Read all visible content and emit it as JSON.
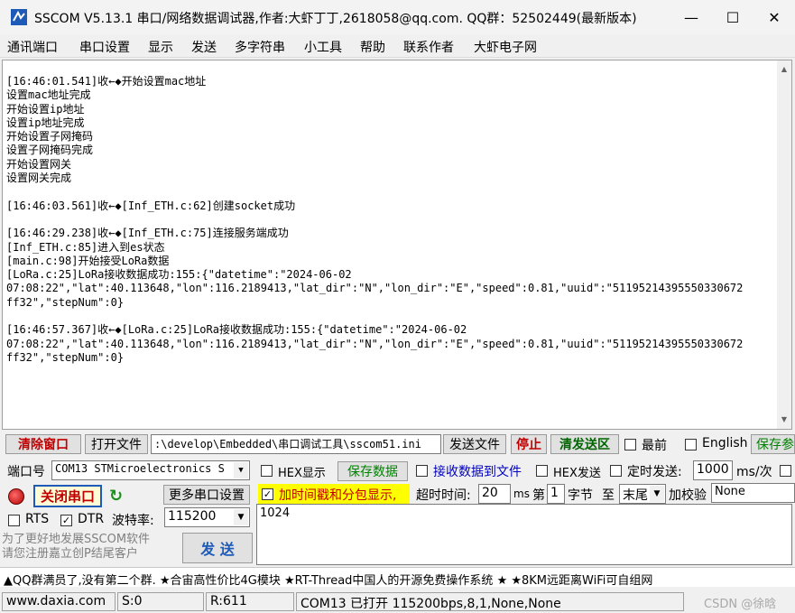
{
  "window": {
    "title": "SSCOM V5.13.1 串口/网络数据调试器,作者:大虾丁丁,2618058@qq.com. QQ群：52502449(最新版本)",
    "minimize": "—",
    "maximize": "☐",
    "close": "✕"
  },
  "menu": [
    "通讯端口",
    "串口设置",
    "显示",
    "发送",
    "多字符串",
    "小工具",
    "帮助",
    "联系作者",
    "大虾电子网"
  ],
  "receive": {
    "lines": [
      "[16:46:01.541]收←◆开始设置mac地址",
      "设置mac地址完成",
      "开始设置ip地址",
      "设置ip地址完成",
      "开始设置子网掩码",
      "设置子网掩码完成",
      "开始设置网关",
      "设置网关完成",
      "",
      "[16:46:03.561]收←◆[Inf_ETH.c:62]创建socket成功",
      "",
      "[16:46:29.238]收←◆[Inf_ETH.c:75]连接服务端成功",
      "[Inf_ETH.c:85]进入到es状态",
      "[main.c:98]开始接受LoRa数据",
      "[LoRa.c:25]LoRa接收数据成功:155:{\"datetime\":\"2024-06-02",
      "07:08:22\",\"lat\":40.113648,\"lon\":116.2189413,\"lat_dir\":\"N\",\"lon_dir\":\"E\",\"speed\":0.81,\"uuid\":\"51195214395550330672",
      "ff32\",\"stepNum\":0}",
      "",
      "[16:46:57.367]收←◆[LoRa.c:25]LoRa接收数据成功:155:{\"datetime\":\"2024-06-02",
      "07:08:22\",\"lat\":40.113648,\"lon\":116.2189413,\"lat_dir\":\"N\",\"lon_dir\":\"E\",\"speed\":0.81,\"uuid\":\"51195214395550330672",
      "ff32\",\"stepNum\":0}"
    ]
  },
  "toolbar": {
    "clear_window": "清除窗口",
    "open_file": "打开文件",
    "file_path": ":\\develop\\Embedded\\串口调试工具\\sscom51.ini",
    "send_file": "发送文件",
    "stop": "停止",
    "clear_send": "清发送区",
    "topmost": "最前",
    "english": "English",
    "save_params": "保存参"
  },
  "port": {
    "port_label": "端口号",
    "port_value": "COM13 STMicroelectronics S",
    "close_port": "关闭串口",
    "more_settings": "更多串口设置",
    "rts": "RTS",
    "dtr": "DTR",
    "baud_label": "波特率:",
    "baud_value": "115200"
  },
  "display": {
    "hex_display": "HEX显示",
    "save_data": "保存数据",
    "recv_to_file": "接收数据到文件",
    "hex_send": "HEX发送",
    "timed_send": "定时发送:",
    "interval": "1000",
    "interval_unit": "ms/次",
    "timestamp": "加时间戳和分包显示,",
    "timeout_label": "超时时间:",
    "timeout": "20",
    "timeout_unit": "ms",
    "byte_prefix": "第",
    "byte_index": "1",
    "byte_suffix": "字节",
    "to": "至",
    "end_option": "末尾",
    "checksum_label": "加校验",
    "checksum_value": "None"
  },
  "send": {
    "text": "1024",
    "send_button": "发  送"
  },
  "ad": {
    "line1": "为了更好地发展SSCOM软件",
    "line2": "请您注册嘉立创P结尾客户"
  },
  "ticker": "▲QQ群满员了,没有第二个群. ★合宙高性价比4G模块 ★RT-Thread中国人的开源免费操作系统 ★ ★8KM远距离WiFi可自组网",
  "status": {
    "url": "www.daxia.com",
    "sent": "S:0",
    "received": "R:611",
    "port_info": "COM13 已打开  115200bps,8,1,None,None",
    "watermark": "CSDN @徐晗"
  }
}
